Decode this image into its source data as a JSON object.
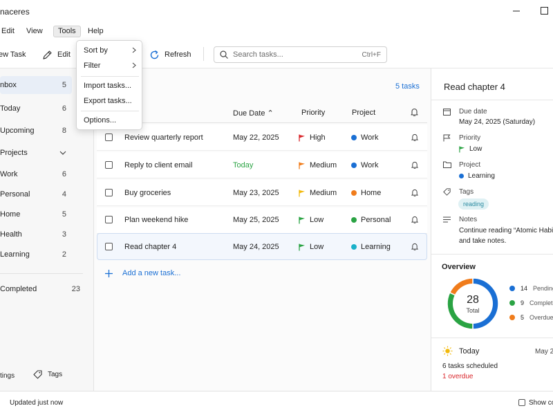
{
  "app": {
    "title": "naceres"
  },
  "menubar": {
    "items": [
      "Edit",
      "View",
      "Tools",
      "Help"
    ]
  },
  "toolbar": {
    "new_task": "ew Task",
    "edit": "Edit",
    "refresh": "Refresh"
  },
  "search": {
    "placeholder": "Search tasks...",
    "shortcut": "Ctrl+F"
  },
  "tools_menu": {
    "sort_by": "Sort by",
    "filter": "Filter",
    "import": "Import tasks...",
    "export": "Export tasks...",
    "options": "Options..."
  },
  "sidebar": {
    "lists": [
      {
        "label": "nbox",
        "count": "5"
      },
      {
        "label": "Today",
        "count": "6"
      },
      {
        "label": "Upcoming",
        "count": "8"
      }
    ],
    "projects_label": "Projects",
    "projects": [
      {
        "label": "Work",
        "count": "6"
      },
      {
        "label": "Personal",
        "count": "4"
      },
      {
        "label": "Home",
        "count": "5"
      },
      {
        "label": "Health",
        "count": "3"
      },
      {
        "label": "Learning",
        "count": "2"
      }
    ],
    "completed": {
      "label": "Completed",
      "count": "23"
    },
    "settings": "tings",
    "tags": "Tags"
  },
  "main": {
    "task_count": "5 tasks",
    "headers": {
      "due": "Due Date",
      "priority": "Priority",
      "project": "Project"
    },
    "tasks": [
      {
        "title": "Review quarterly report",
        "due": "May 22, 2025",
        "priority": "High",
        "project": "Work"
      },
      {
        "title": "Reply to client email",
        "due": "Today",
        "priority": "Medium",
        "project": "Work"
      },
      {
        "title": "Buy groceries",
        "due": "May 23, 2025",
        "priority": "Medium",
        "project": "Home"
      },
      {
        "title": "Plan weekend hike",
        "due": "May 25, 2025",
        "priority": "Low",
        "project": "Personal"
      },
      {
        "title": "Read chapter 4",
        "due": "May 24, 2025",
        "priority": "Low",
        "project": "Learning"
      }
    ],
    "add_task": "Add a new task..."
  },
  "colors": {
    "accent": "#1a6fd4",
    "high": "#d9262b",
    "medium": "#f07c1b",
    "medium_yellow": "#f2b90c",
    "low": "#2aa343",
    "work": "#1a6fd4",
    "home": "#f07c1b",
    "personal": "#2aa343",
    "learning": "#1bb1c9",
    "today_text": "#2aa343",
    "overdue": "#d9262b"
  },
  "detail": {
    "title": "Read chapter 4",
    "due_label": "Due date",
    "due_value": "May 24, 2025 (Saturday)",
    "priority_label": "Priority",
    "priority_value": "Low",
    "project_label": "Project",
    "project_value": "Learning",
    "tags_label": "Tags",
    "tag": "reading",
    "notes_label": "Notes",
    "notes_line1": "Continue reading “Atomic Habits”",
    "notes_line2": "and take notes."
  },
  "overview": {
    "title": "Overview",
    "total": "28",
    "total_label": "Total",
    "legend": [
      {
        "count": "14",
        "label": "Pending",
        "value": 14,
        "color": "#1a6fd4"
      },
      {
        "count": "9",
        "label": "Completed",
        "value": 9,
        "color": "#2aa343"
      },
      {
        "count": "5",
        "label": "Overdue",
        "value": 5,
        "color": "#f07c1b"
      }
    ]
  },
  "today_panel": {
    "title": "Today",
    "date": "May 2",
    "scheduled": "6 tasks scheduled",
    "overdue": "1 overdue"
  },
  "status": {
    "updated": "Updated just now",
    "show": "Show co"
  }
}
